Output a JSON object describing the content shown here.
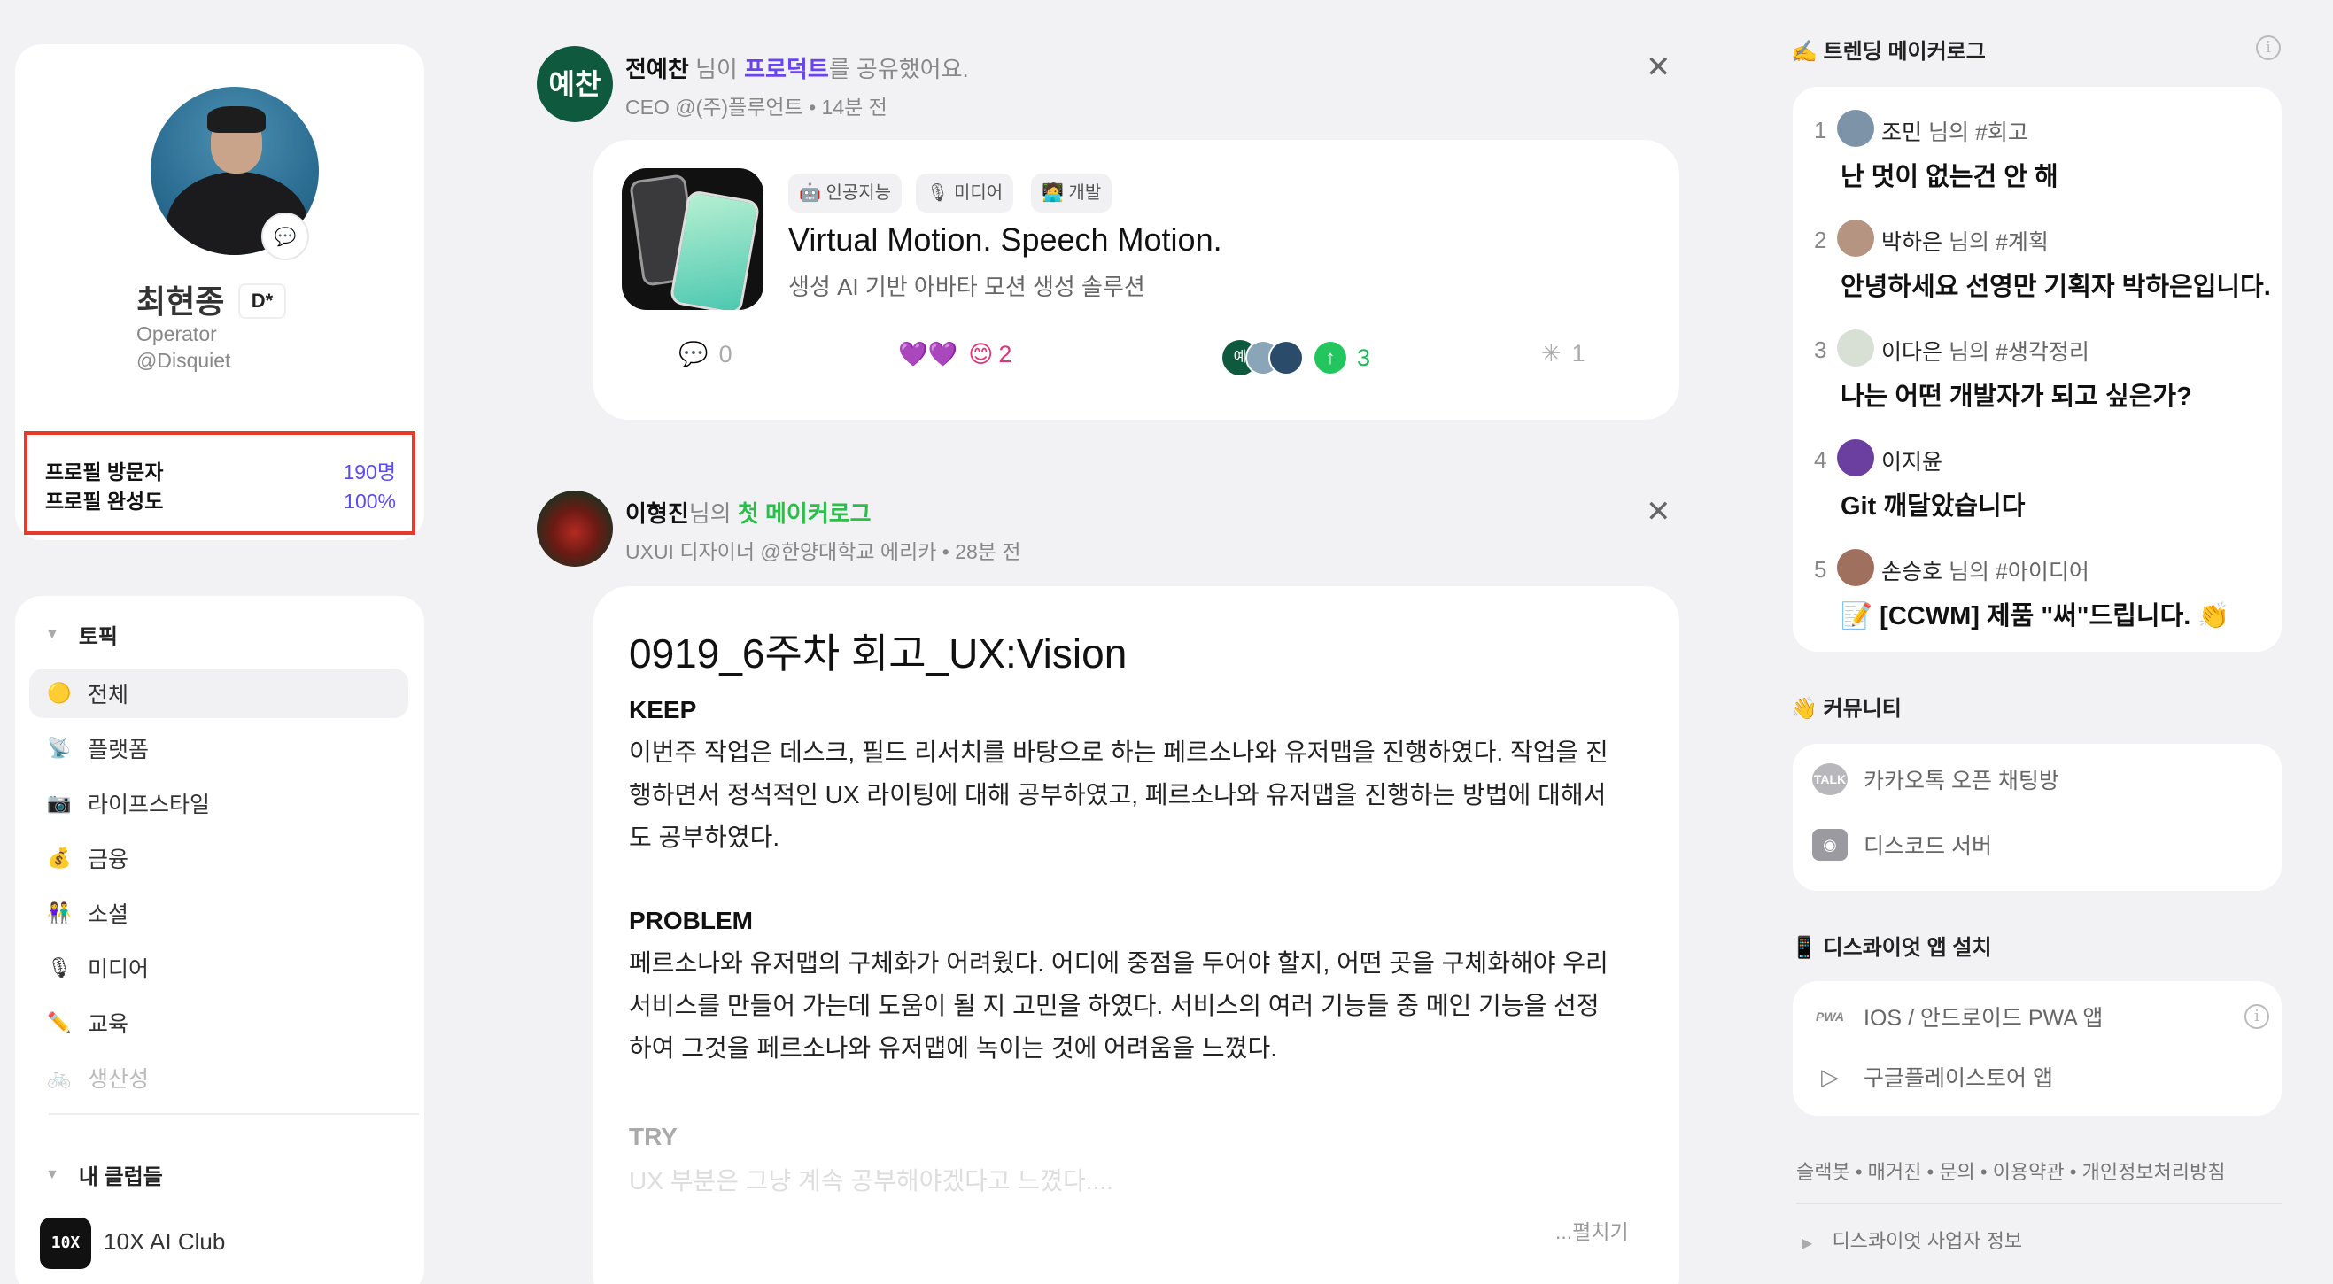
{
  "profile": {
    "name": "최현종",
    "badge": "D*",
    "role": "Operator",
    "handle": "@Disquiet",
    "stats": [
      {
        "label": "프로필 방문자",
        "value": "190명"
      },
      {
        "label": "프로필 완성도",
        "value": "100%"
      }
    ]
  },
  "topics": {
    "heading": "토픽",
    "items": [
      {
        "icon": "🟡",
        "label": "전체"
      },
      {
        "icon": "📡",
        "label": "플랫폼"
      },
      {
        "icon": "📷",
        "label": "라이프스타일"
      },
      {
        "icon": "💰",
        "label": "금융"
      },
      {
        "icon": "👫",
        "label": "소셜"
      },
      {
        "icon": "🎙",
        "label": "미디어"
      },
      {
        "icon": "✏️",
        "label": "교육"
      },
      {
        "icon": "🚲",
        "label": "생산성"
      }
    ]
  },
  "clubs": {
    "heading": "내 클럽들",
    "items": [
      {
        "logo": "10X",
        "name": "10X AI Club"
      }
    ]
  },
  "feed": [
    {
      "avatar": "예찬",
      "author": "전예찬",
      "verb_pre": "님이",
      "link": "프로덕트",
      "verb_post": "를 공유했어요.",
      "sub": "CEO @(주)플루언트 • 14분 전",
      "product": {
        "tags": [
          "🤖 인공지능",
          "🎙 미디어",
          "🧑‍💻 개발"
        ],
        "name": "Virtual Motion. Speech Motion.",
        "desc": "생성 AI 기반 아바타 모션 생성 솔루션",
        "comments": "0",
        "reactions": "2",
        "upvotes": "3",
        "clicks": "1",
        "upvoter_initial": "예"
      }
    },
    {
      "author": "이형진",
      "verb_pre": "님의",
      "link": "첫 메이커로그",
      "sub": "UXUI 디자이너 @한양대학교 에리카 • 28분 전",
      "post": {
        "title": "0919_6주차 회고_UX:Vision",
        "keep_h": "KEEP",
        "keep_p": "이번주 작업은 데스크, 필드 리서치를 바탕으로 하는 페르소나와 유저맵을 진행하였다. 작업을 진행하면서 정석적인 UX 라이팅에 대해 공부하였고, 페르소나와 유저맵을 진행하는 방법에 대해서도 공부하였다.",
        "problem_h": "PROBLEM",
        "problem_p": "페르소나와 유저맵의 구체화가 어려웠다. 어디에 중점을 두어야 할지, 어떤 곳을 구체화해야 우리 서비스를 만들어 가는데 도움이 될 지 고민을 하였다. 서비스의 여러 기능들 중 메인 기능을 선정하여 그것을 페르소나와 유저맵에 녹이는 것에 어려움을 느꼈다.",
        "try_h": "TRY",
        "try_p": "UX 부분은 그냥 계속 공부해야겠다고 느꼈다....",
        "expand": "...펼치기"
      }
    }
  ],
  "trending": {
    "heading": "✍️ 트렌딩 메이커로그",
    "items": [
      {
        "rank": "1",
        "user": "조민",
        "suffix": "님의 #회고",
        "title": "난 멋이 없는건 안 해"
      },
      {
        "rank": "2",
        "user": "박하은",
        "suffix": "님의 #계획",
        "title": "안녕하세요 선영만 기획자 박하은입니다."
      },
      {
        "rank": "3",
        "user": "이다은",
        "suffix": "님의 #생각정리",
        "title": "나는 어떤 개발자가 되고 싶은가?"
      },
      {
        "rank": "4",
        "user": "이지윤",
        "suffix": "",
        "title": "Git 깨달았습니다"
      },
      {
        "rank": "5",
        "user": "손승호",
        "suffix": "님의 #아이디어",
        "title": "📝 [CCWM] 제품 \"써\"드립니다. 👏"
      }
    ]
  },
  "community": {
    "heading": "👋 커뮤니티",
    "items": [
      {
        "icon": "TALK",
        "label": "카카오톡 오픈 채팅방"
      },
      {
        "icon": "discord",
        "label": "디스코드 서버"
      }
    ]
  },
  "app": {
    "heading": "📱 디스콰이엇 앱 설치",
    "items": [
      {
        "icon": "PWA",
        "label": "IOS / 안드로이드 PWA 앱"
      },
      {
        "icon": "play",
        "label": "구글플레이스토어 앱"
      }
    ]
  },
  "footer": {
    "links": "슬랙봇 • 매거진 • 문의 • 이용약관 • 개인정보처리방침",
    "biz": "디스콰이엇 사업자 정보"
  }
}
